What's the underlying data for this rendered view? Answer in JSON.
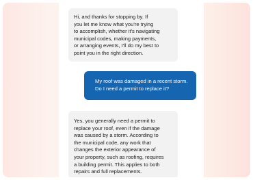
{
  "chat": {
    "messages": [
      {
        "role": "assistant",
        "text": "Hi, and thanks for stopping by. If\nyou let me know what you're trying\nto accomplish, whether it's navigating\nmunicipal codes, making payments,\nor arranging events, I'll do my best to\npoint you in the right direction."
      },
      {
        "role": "user",
        "text": "My roof was damaged in a recent storm.\nDo I need a permit to replace it?"
      },
      {
        "role": "assistant",
        "text": "Yes, you generally need a permit to\nreplace your roof, even if the damage\nwas caused by a storm. According to\nthe municipal code, any work that\nchanges the exterior appearance of\nyour property, such as roofing, requires\na building permit. This applies to both\nrepairs and full replacements."
      }
    ]
  },
  "colors": {
    "user_bubble": "#1565b0",
    "assistant_bubble": "#f2f2f2"
  }
}
